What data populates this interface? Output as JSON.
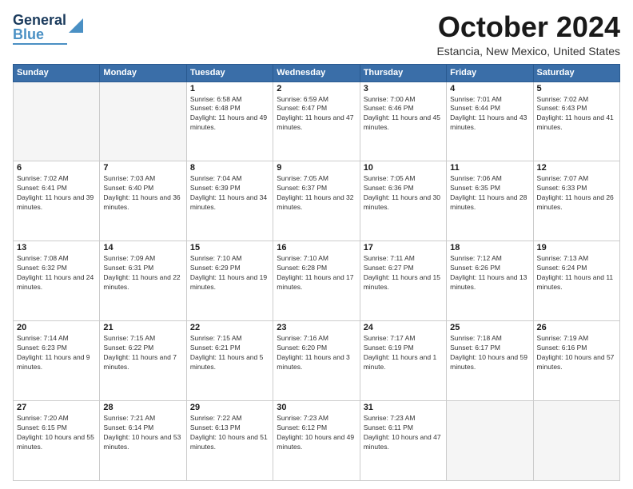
{
  "app": {
    "logo_general": "General",
    "logo_blue": "Blue"
  },
  "header": {
    "month_title": "October 2024",
    "location": "Estancia, New Mexico, United States"
  },
  "days_of_week": [
    "Sunday",
    "Monday",
    "Tuesday",
    "Wednesday",
    "Thursday",
    "Friday",
    "Saturday"
  ],
  "weeks": [
    [
      {
        "day": "",
        "info": ""
      },
      {
        "day": "",
        "info": ""
      },
      {
        "day": "1",
        "info": "Sunrise: 6:58 AM\nSunset: 6:48 PM\nDaylight: 11 hours and 49 minutes."
      },
      {
        "day": "2",
        "info": "Sunrise: 6:59 AM\nSunset: 6:47 PM\nDaylight: 11 hours and 47 minutes."
      },
      {
        "day": "3",
        "info": "Sunrise: 7:00 AM\nSunset: 6:46 PM\nDaylight: 11 hours and 45 minutes."
      },
      {
        "day": "4",
        "info": "Sunrise: 7:01 AM\nSunset: 6:44 PM\nDaylight: 11 hours and 43 minutes."
      },
      {
        "day": "5",
        "info": "Sunrise: 7:02 AM\nSunset: 6:43 PM\nDaylight: 11 hours and 41 minutes."
      }
    ],
    [
      {
        "day": "6",
        "info": "Sunrise: 7:02 AM\nSunset: 6:41 PM\nDaylight: 11 hours and 39 minutes."
      },
      {
        "day": "7",
        "info": "Sunrise: 7:03 AM\nSunset: 6:40 PM\nDaylight: 11 hours and 36 minutes."
      },
      {
        "day": "8",
        "info": "Sunrise: 7:04 AM\nSunset: 6:39 PM\nDaylight: 11 hours and 34 minutes."
      },
      {
        "day": "9",
        "info": "Sunrise: 7:05 AM\nSunset: 6:37 PM\nDaylight: 11 hours and 32 minutes."
      },
      {
        "day": "10",
        "info": "Sunrise: 7:05 AM\nSunset: 6:36 PM\nDaylight: 11 hours and 30 minutes."
      },
      {
        "day": "11",
        "info": "Sunrise: 7:06 AM\nSunset: 6:35 PM\nDaylight: 11 hours and 28 minutes."
      },
      {
        "day": "12",
        "info": "Sunrise: 7:07 AM\nSunset: 6:33 PM\nDaylight: 11 hours and 26 minutes."
      }
    ],
    [
      {
        "day": "13",
        "info": "Sunrise: 7:08 AM\nSunset: 6:32 PM\nDaylight: 11 hours and 24 minutes."
      },
      {
        "day": "14",
        "info": "Sunrise: 7:09 AM\nSunset: 6:31 PM\nDaylight: 11 hours and 22 minutes."
      },
      {
        "day": "15",
        "info": "Sunrise: 7:10 AM\nSunset: 6:29 PM\nDaylight: 11 hours and 19 minutes."
      },
      {
        "day": "16",
        "info": "Sunrise: 7:10 AM\nSunset: 6:28 PM\nDaylight: 11 hours and 17 minutes."
      },
      {
        "day": "17",
        "info": "Sunrise: 7:11 AM\nSunset: 6:27 PM\nDaylight: 11 hours and 15 minutes."
      },
      {
        "day": "18",
        "info": "Sunrise: 7:12 AM\nSunset: 6:26 PM\nDaylight: 11 hours and 13 minutes."
      },
      {
        "day": "19",
        "info": "Sunrise: 7:13 AM\nSunset: 6:24 PM\nDaylight: 11 hours and 11 minutes."
      }
    ],
    [
      {
        "day": "20",
        "info": "Sunrise: 7:14 AM\nSunset: 6:23 PM\nDaylight: 11 hours and 9 minutes."
      },
      {
        "day": "21",
        "info": "Sunrise: 7:15 AM\nSunset: 6:22 PM\nDaylight: 11 hours and 7 minutes."
      },
      {
        "day": "22",
        "info": "Sunrise: 7:15 AM\nSunset: 6:21 PM\nDaylight: 11 hours and 5 minutes."
      },
      {
        "day": "23",
        "info": "Sunrise: 7:16 AM\nSunset: 6:20 PM\nDaylight: 11 hours and 3 minutes."
      },
      {
        "day": "24",
        "info": "Sunrise: 7:17 AM\nSunset: 6:19 PM\nDaylight: 11 hours and 1 minute."
      },
      {
        "day": "25",
        "info": "Sunrise: 7:18 AM\nSunset: 6:17 PM\nDaylight: 10 hours and 59 minutes."
      },
      {
        "day": "26",
        "info": "Sunrise: 7:19 AM\nSunset: 6:16 PM\nDaylight: 10 hours and 57 minutes."
      }
    ],
    [
      {
        "day": "27",
        "info": "Sunrise: 7:20 AM\nSunset: 6:15 PM\nDaylight: 10 hours and 55 minutes."
      },
      {
        "day": "28",
        "info": "Sunrise: 7:21 AM\nSunset: 6:14 PM\nDaylight: 10 hours and 53 minutes."
      },
      {
        "day": "29",
        "info": "Sunrise: 7:22 AM\nSunset: 6:13 PM\nDaylight: 10 hours and 51 minutes."
      },
      {
        "day": "30",
        "info": "Sunrise: 7:23 AM\nSunset: 6:12 PM\nDaylight: 10 hours and 49 minutes."
      },
      {
        "day": "31",
        "info": "Sunrise: 7:23 AM\nSunset: 6:11 PM\nDaylight: 10 hours and 47 minutes."
      },
      {
        "day": "",
        "info": ""
      },
      {
        "day": "",
        "info": ""
      }
    ]
  ]
}
